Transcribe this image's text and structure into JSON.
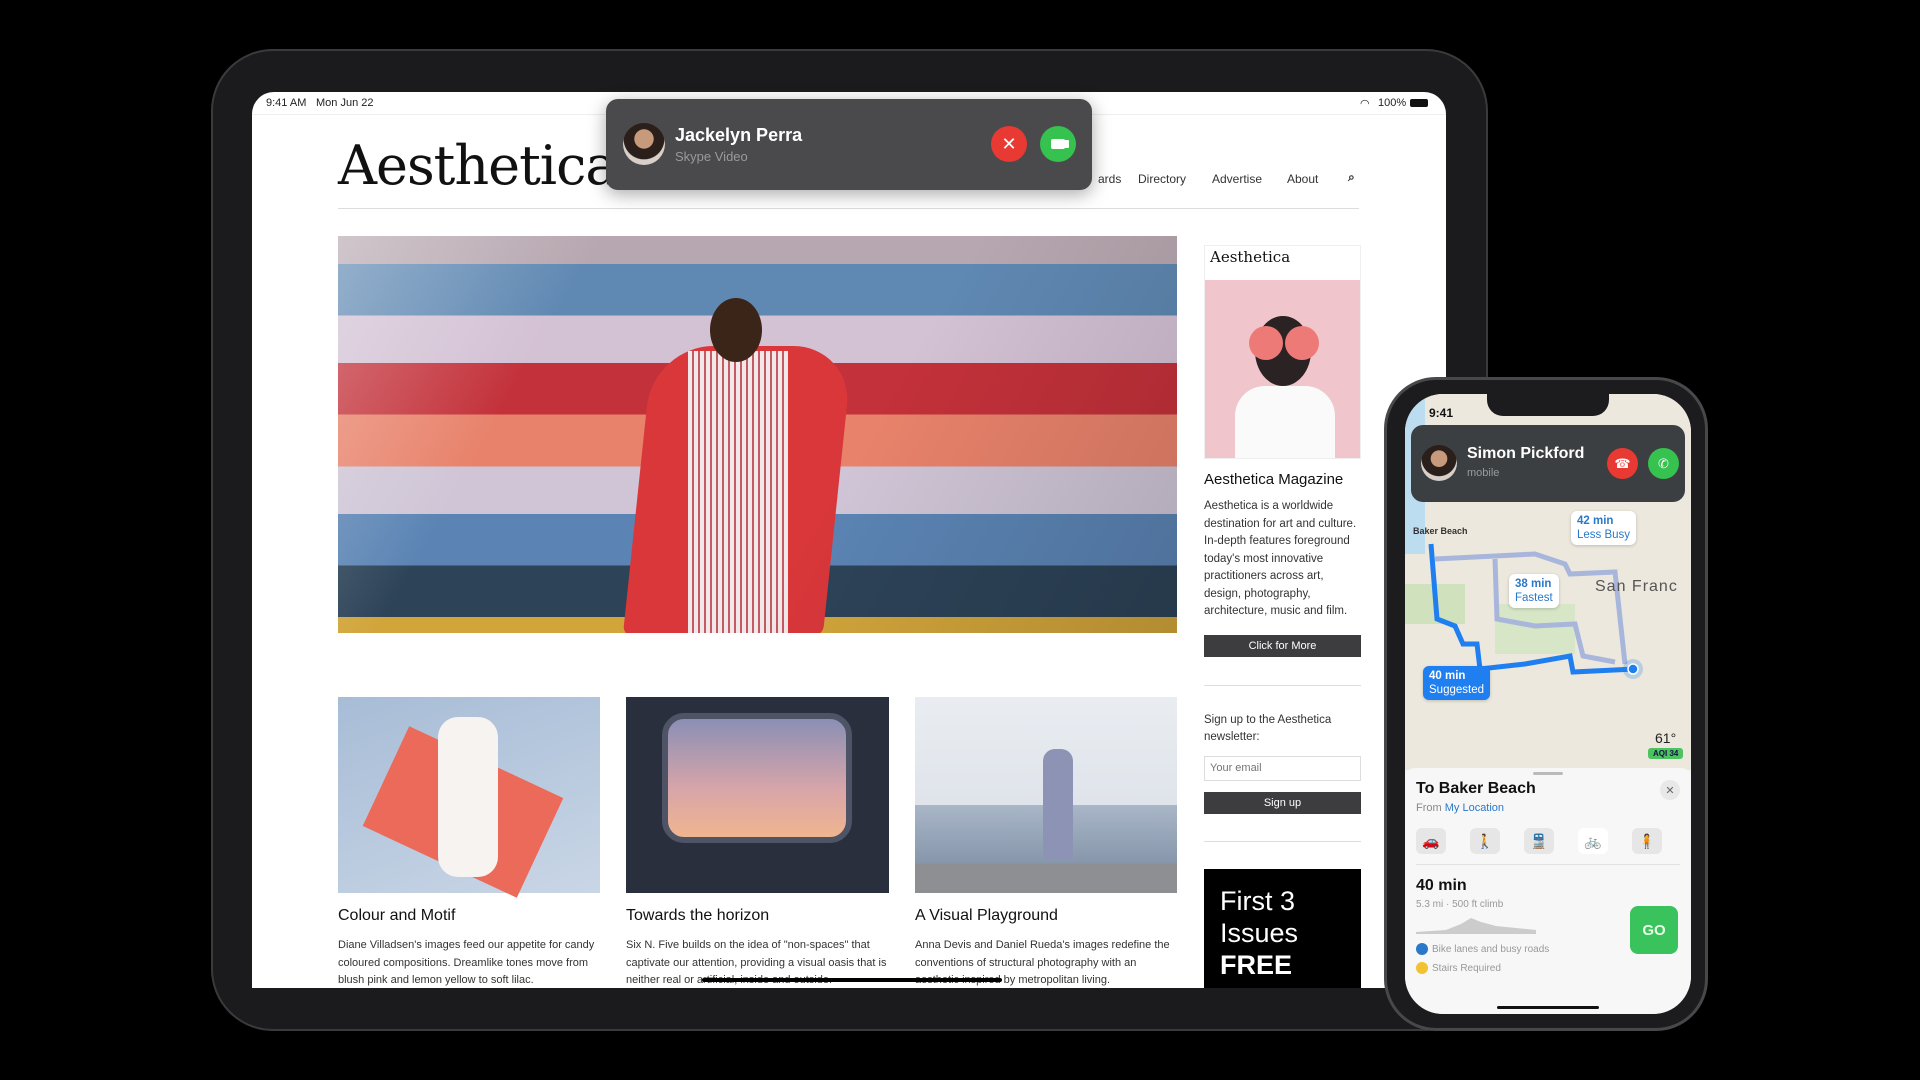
{
  "ipad": {
    "status": {
      "time": "9:41 AM",
      "date": "Mon Jun 22",
      "battery": "100%"
    },
    "call": {
      "name": "Jackelyn Perra",
      "subtitle": "Skype Video",
      "decline_icon": "close-icon",
      "accept_icon": "video-camera-icon"
    },
    "site": {
      "logo": "Aesthetica",
      "nav": [
        "ards",
        "Directory",
        "Advertise",
        "About"
      ],
      "sidebar": {
        "cover_logo": "Aesthetica",
        "title": "Aesthetica Magazine",
        "description": "Aesthetica is a worldwide destination for art and culture. In-depth features foreground today's most innovative practitioners across art, design, photography, architecture, music and film.",
        "cta": "Click for More",
        "newsletter_text": "Sign up to the Aesthetica newsletter:",
        "email_placeholder": "Your email",
        "signup": "Sign up",
        "ad_line1": "First 3",
        "ad_line2": "Issues",
        "ad_line3": "FREE"
      },
      "cards": [
        {
          "title": "Colour and Motif",
          "text": "Diane Villadsen's images feed our appetite for candy coloured compositions. Dreamlike tones move from blush pink and lemon yellow to soft lilac."
        },
        {
          "title": "Towards the horizon",
          "text": "Six N. Five builds on the idea of \"non-spaces\" that captivate our attention, providing a visual oasis that is neither real or artificial, inside and outside."
        },
        {
          "title": "A Visual Playground",
          "text": "Anna Devis and Daniel Rueda's images redefine the conventions of structural photography with an aesthetic inspired by metropolitan living."
        }
      ]
    }
  },
  "iphone": {
    "status": {
      "time": "9:41"
    },
    "call": {
      "name": "Simon Pickford",
      "subtitle": "mobile"
    },
    "map": {
      "labels": {
        "baker_beach": "Baker Beach",
        "city": "San Franc",
        "temp": "61°",
        "aqi": "AQI 34"
      },
      "routes": [
        {
          "time": "42 min",
          "label": "Less Busy"
        },
        {
          "time": "38 min",
          "label": "Fastest"
        },
        {
          "time": "40 min",
          "label": "Suggested"
        }
      ]
    },
    "directions": {
      "title": "To Baker Beach",
      "from_prefix": "From",
      "from_location": "My Location",
      "modes": [
        {
          "icon": "car-icon",
          "glyph": "🚗"
        },
        {
          "icon": "walk-icon",
          "glyph": "🚶"
        },
        {
          "icon": "transit-icon",
          "glyph": "🚆"
        },
        {
          "icon": "bike-icon",
          "glyph": "🚲",
          "selected": true
        },
        {
          "icon": "rideshare-icon",
          "glyph": "🧍"
        }
      ],
      "duration": "40 min",
      "details": "5.3 mi · 500 ft climb",
      "notes": [
        "Bike lanes and busy roads",
        "Stairs Required"
      ],
      "go": "GO"
    }
  },
  "colors": {
    "decline": "#e83a33",
    "accept": "#35c24f",
    "maps_blue": "#1f7ef0",
    "go": "#3ac35c"
  }
}
